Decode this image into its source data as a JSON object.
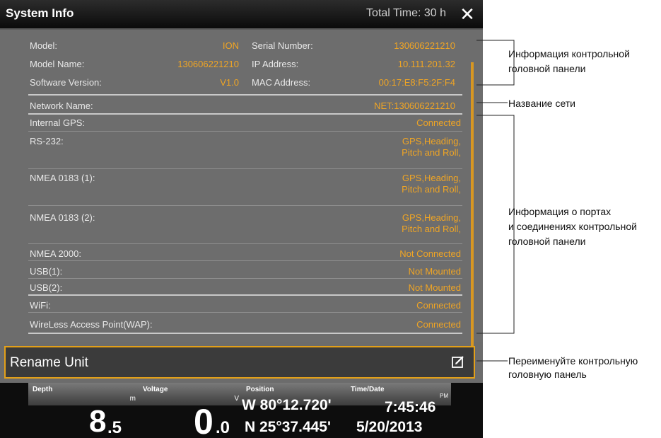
{
  "window": {
    "title": "System Info",
    "total_time": "Total Time: 30 h",
    "close_glyph": "✕"
  },
  "head_info": {
    "model_label": "Model:",
    "model_value": "ION",
    "serial_label": "Serial Number:",
    "serial_value": "130606221210",
    "model_name_label": "Model Name:",
    "model_name_value": "130606221210",
    "ip_label": "IP Address:",
    "ip_value": "10.111.201.32",
    "software_label": "Software Version:",
    "software_value": "V1.0",
    "mac_label": "MAC Address:",
    "mac_value": "00:17:E8:F5:2F:F4"
  },
  "network": {
    "label": "Network Name:",
    "value": "NET:130606221210"
  },
  "ports": [
    {
      "label": "Internal GPS:",
      "value": "Connected"
    },
    {
      "label": "RS-232:",
      "value": "GPS,Heading,\nPitch and Roll,"
    },
    {
      "label": "NMEA 0183 (1):",
      "value": "GPS,Heading,\nPitch and Roll,"
    },
    {
      "label": "NMEA 0183 (2):",
      "value": "GPS,Heading,\nPitch and Roll,"
    },
    {
      "label": "NMEA 2000:",
      "value": "Not Connected"
    },
    {
      "label": "USB(1):",
      "value": "Not Mounted"
    },
    {
      "label": "USB(2):",
      "value": "Not Mounted"
    },
    {
      "label": "WiFi:",
      "value": "Connected"
    },
    {
      "label": "WireLess Access Point(WAP):",
      "value": "Connected"
    }
  ],
  "rename": {
    "label": "Rename Unit",
    "icon": "edit-icon"
  },
  "databar": {
    "depth": {
      "label": "Depth",
      "unit": "m",
      "int": "8",
      "dec": ".5"
    },
    "voltage": {
      "label": "Voltage",
      "unit": "V",
      "int": "0",
      "dec": ".0"
    },
    "position": {
      "label": "Position",
      "lon": "W 80°12.720'",
      "lat": "N 25°37.445'"
    },
    "time": {
      "label": "Time/Date",
      "ampm": "PM",
      "time": "7:45:46",
      "date": "5/20/2013"
    }
  },
  "callouts": {
    "head_info": "Информация контрольной\nголовной панели",
    "network": "Название сети",
    "ports": "Информация о портах\nи соединениях контрольной\nголовной панели",
    "rename": "Переименуйте контрольную\nголовную панель"
  },
  "colors": {
    "accent": "#f0a524",
    "callout_line": "#222222"
  }
}
